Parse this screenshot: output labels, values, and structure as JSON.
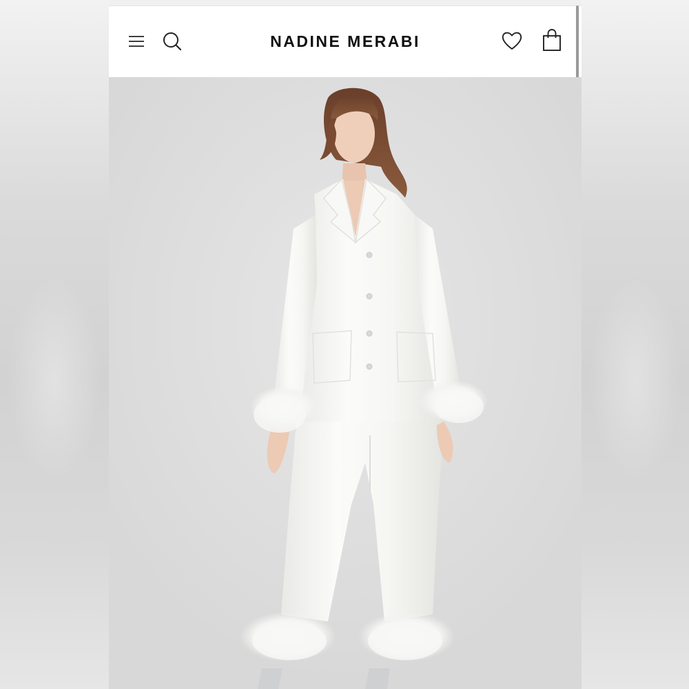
{
  "header": {
    "brand": "NADINE MERABI",
    "icons": {
      "menu": "hamburger-menu-icon",
      "search": "search-icon",
      "wishlist": "heart-icon",
      "bag": "shopping-bag-icon"
    }
  },
  "product_image": {
    "subject": "model-in-white-feather-trim-pyjama-set",
    "background_color": "#dcdcdc",
    "garment_color": "#f8f8f6"
  }
}
